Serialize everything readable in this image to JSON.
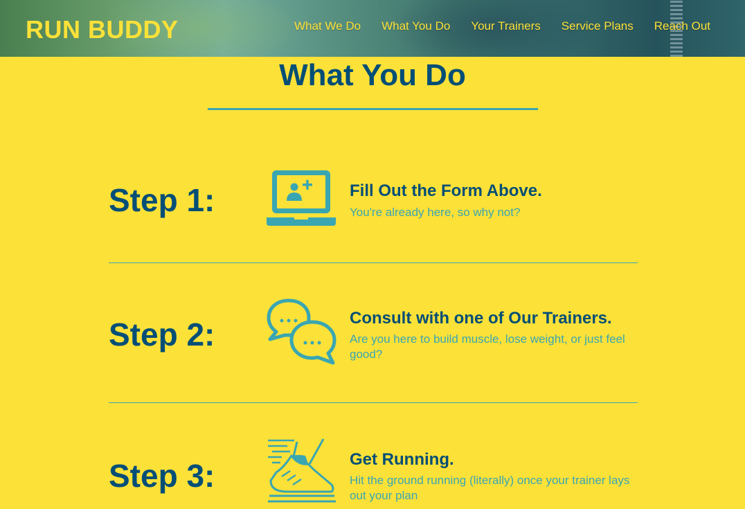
{
  "header": {
    "logo": "RUN BUDDY",
    "nav": [
      "What We Do",
      "What You Do",
      "Your Trainers",
      "Service Plans",
      "Reach Out"
    ]
  },
  "section": {
    "title": "What You Do",
    "steps": [
      {
        "label": "Step 1:",
        "heading": "Fill Out the Form Above.",
        "desc": "You're already here, so why not?",
        "icon": "laptop-add-user-icon"
      },
      {
        "label": "Step 2:",
        "heading": "Consult with one of Our Trainers.",
        "desc": "Are you here to build muscle, lose weight, or just feel good?",
        "icon": "chat-bubbles-icon"
      },
      {
        "label": "Step 3:",
        "heading": "Get Running.",
        "desc": "Hit the ground running (literally) once your trainer lays out your plan",
        "icon": "running-shoe-icon"
      }
    ]
  },
  "colors": {
    "background": "#fce138",
    "primary": "#024e76",
    "accent": "#39a6b2"
  }
}
